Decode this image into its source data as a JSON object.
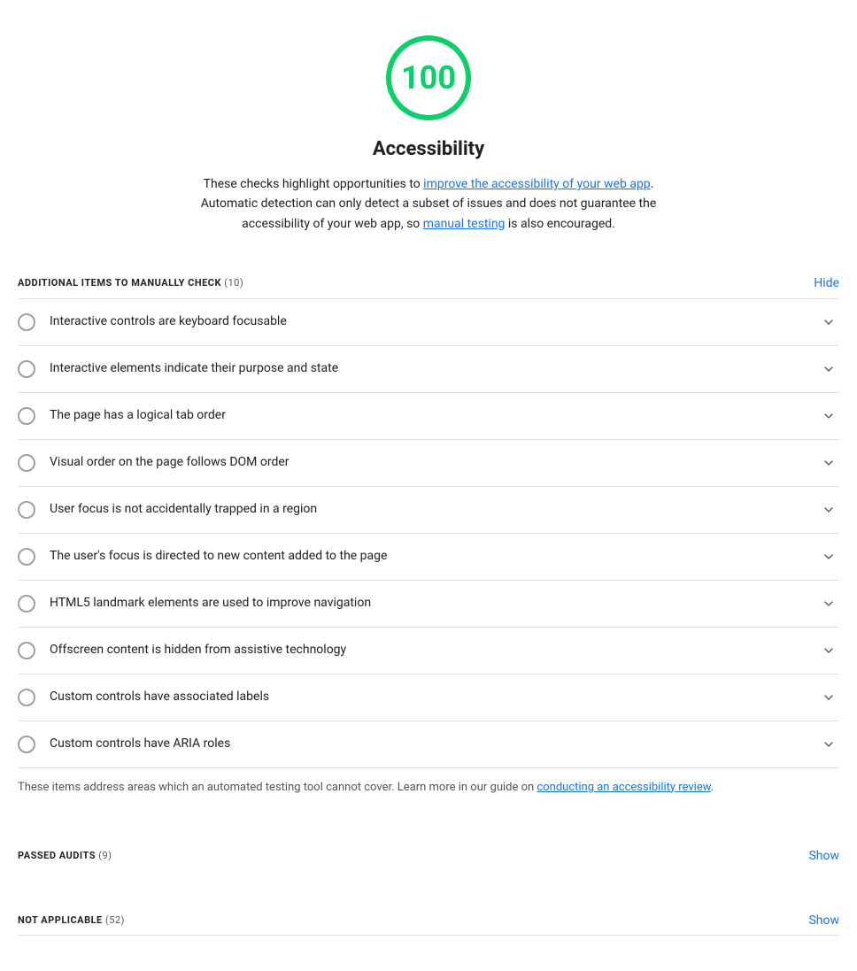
{
  "score": {
    "value": "100",
    "title": "Accessibility",
    "description_part1": "These checks highlight opportunities to ",
    "description_link1_text": "improve the accessibility of your web app",
    "description_link1_href": "#",
    "description_part2": ". Automatic detection can only detect a subset of issues and does not guarantee the accessibility of your web app, so ",
    "description_link2_text": "manual testing",
    "description_link2_href": "#",
    "description_part3": " is also encouraged."
  },
  "manual_section": {
    "title": "ADDITIONAL ITEMS TO MANUALLY CHECK",
    "count": "(10)",
    "action_label": "Hide"
  },
  "audit_items": [
    {
      "id": "keyboard-focusable",
      "label": "Interactive controls are keyboard focusable"
    },
    {
      "id": "purpose-and-state",
      "label": "Interactive elements indicate their purpose and state"
    },
    {
      "id": "tab-order",
      "label": "The page has a logical tab order"
    },
    {
      "id": "dom-order",
      "label": "Visual order on the page follows DOM order"
    },
    {
      "id": "focus-trap",
      "label": "User focus is not accidentally trapped in a region"
    },
    {
      "id": "focus-new-content",
      "label": "The user's focus is directed to new content added to the page"
    },
    {
      "id": "landmark-elements",
      "label": "HTML5 landmark elements are used to improve navigation"
    },
    {
      "id": "offscreen-content",
      "label": "Offscreen content is hidden from assistive technology"
    },
    {
      "id": "associated-labels",
      "label": "Custom controls have associated labels"
    },
    {
      "id": "aria-roles",
      "label": "Custom controls have ARIA roles"
    }
  ],
  "manual_note": {
    "prefix": "These items address areas which an automated testing tool cannot cover. Learn more in our guide on ",
    "link_text": "conducting an accessibility review",
    "link_href": "#",
    "suffix": "."
  },
  "passed_section": {
    "title": "PASSED AUDITS",
    "count": "(9)",
    "action_label": "Show"
  },
  "not_applicable_section": {
    "title": "NOT APPLICABLE",
    "count": "(52)",
    "action_label": "Show"
  }
}
